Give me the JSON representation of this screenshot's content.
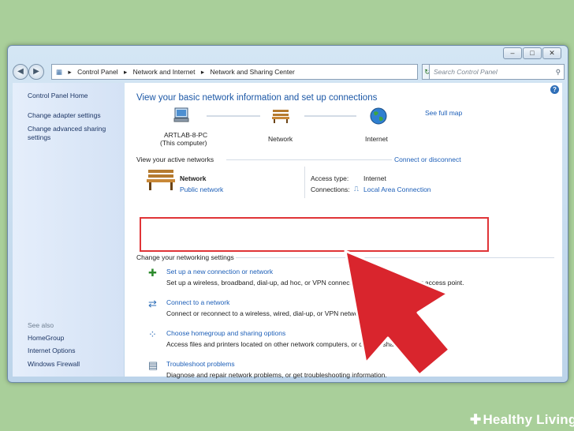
{
  "address": {
    "crumbs": [
      "Control Panel",
      "Network and Internet",
      "Network and Sharing Center"
    ],
    "separator": "▸"
  },
  "search": {
    "placeholder": "Search Control Panel"
  },
  "sidebar": {
    "home": "Control Panel Home",
    "links": [
      "Change adapter settings",
      "Change advanced sharing settings"
    ],
    "see_also_heading": "See also",
    "see_also": [
      "HomeGroup",
      "Internet Options",
      "Windows Firewall"
    ]
  },
  "main": {
    "title": "View your basic network information and set up connections",
    "see_full_map": "See full map",
    "map": {
      "computer_name": "ARTLAB-8-PC",
      "computer_sub": "(This computer)",
      "network": "Network",
      "internet": "Internet"
    },
    "active_heading": "View your active networks",
    "connect_disconnect": "Connect or disconnect",
    "active_network": {
      "name": "Network",
      "type": "Public network",
      "access_type_label": "Access type:",
      "access_type_value": "Internet",
      "connections_label": "Connections:",
      "connections_value": "Local Area Connection"
    },
    "change_heading": "Change your networking settings",
    "tasks": [
      {
        "title": "Set up a new connection or network",
        "desc": "Set up a wireless, broadband, dial-up, ad hoc, or VPN connection; or set up a router or access point."
      },
      {
        "title": "Connect to a network",
        "desc": "Connect or reconnect to a wireless, wired, dial-up, or VPN network connection."
      },
      {
        "title": "Choose homegroup and sharing options",
        "desc": "Access files and printers located on other network computers, or change sharing settings."
      },
      {
        "title": "Troubleshoot problems",
        "desc": "Diagnose and repair network problems, or get troubleshooting information."
      }
    ]
  },
  "watermark": "Healthy Living",
  "colors": {
    "highlight": "#e03437",
    "arrow": "#d9252d",
    "background": "#a9cf9a"
  }
}
